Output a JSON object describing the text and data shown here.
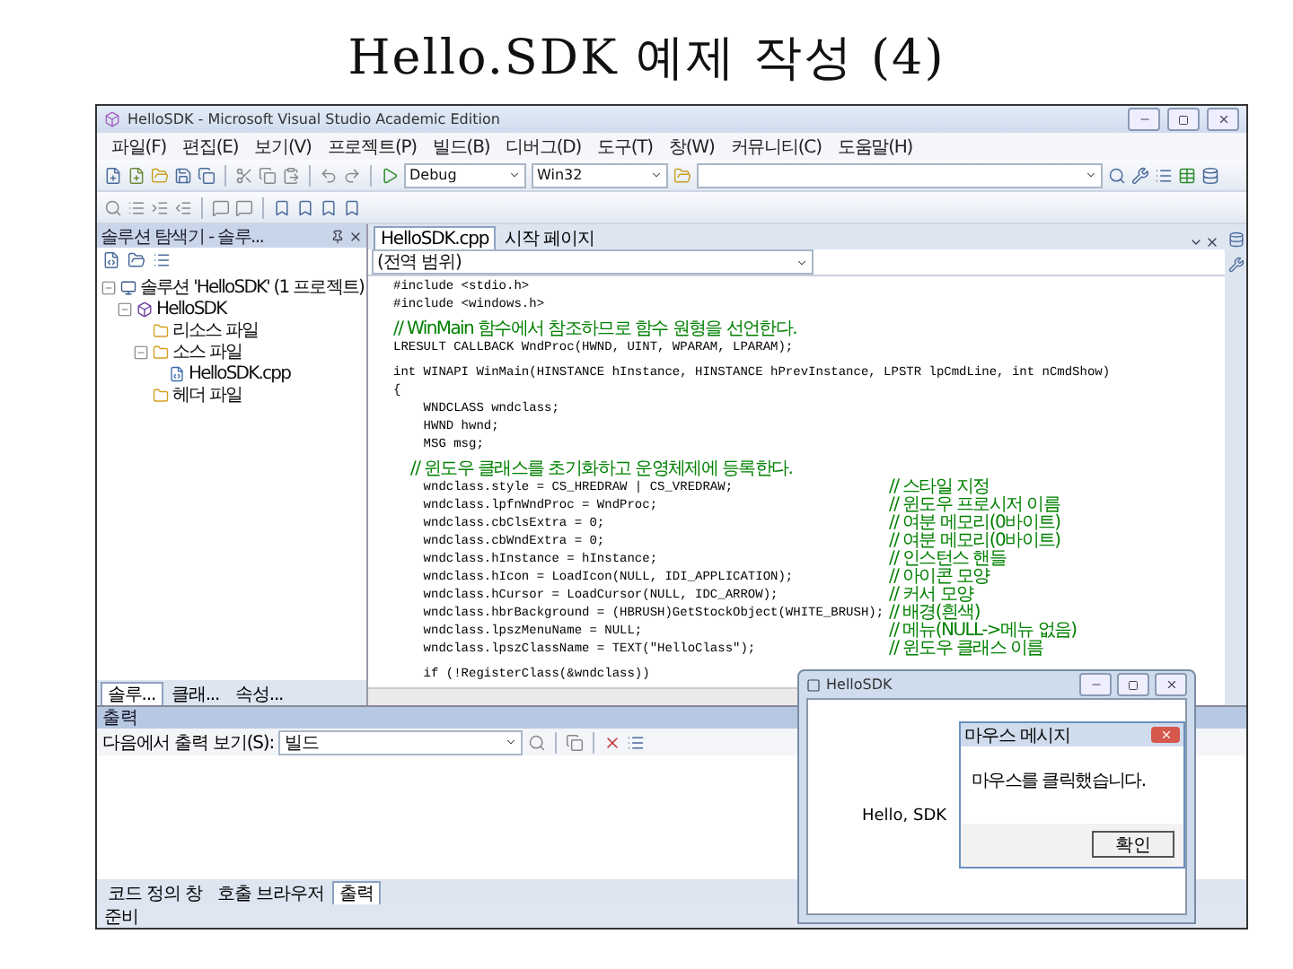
{
  "slide_title": "Hello.SDK 예제 작성 (4)",
  "ide": {
    "window_title": "HelloSDK - Microsoft Visual Studio Academic Edition",
    "menu": [
      "파일(F)",
      "편집(E)",
      "보기(V)",
      "프로젝트(P)",
      "빌드(B)",
      "디버그(D)",
      "도구(T)",
      "창(W)",
      "커뮤니티(C)",
      "도움말(H)"
    ],
    "toolbar": {
      "configuration": "Debug",
      "platform": "Win32"
    },
    "solution_explorer": {
      "title": "솔루션 탐색기 - 솔루...",
      "tree": [
        {
          "label": "솔루션 'HelloSDK' (1 프로젝트)",
          "kind": "solution",
          "children": [
            {
              "label": "HelloSDK",
              "kind": "project",
              "children": [
                {
                  "label": "리소스 파일",
                  "kind": "folder"
                },
                {
                  "label": "소스 파일",
                  "kind": "folder",
                  "children": [
                    {
                      "label": "HelloSDK.cpp",
                      "kind": "file"
                    }
                  ]
                },
                {
                  "label": "헤더 파일",
                  "kind": "folder"
                }
              ]
            }
          ]
        }
      ],
      "tabs": [
        {
          "label": "솔루...",
          "selected": true
        },
        {
          "label": "클래...",
          "selected": false
        },
        {
          "label": "속성...",
          "selected": false
        }
      ]
    },
    "editor": {
      "tabs": [
        {
          "label": "HelloSDK.cpp",
          "selected": true
        },
        {
          "label": "시작 페이지",
          "selected": false
        }
      ],
      "scope": "(전역 범위)",
      "lines": [
        {
          "kind": "code",
          "code": "#include <stdio.h>"
        },
        {
          "kind": "code",
          "code": "#include <windows.h>"
        },
        {
          "kind": "blank"
        },
        {
          "kind": "comment",
          "comment": "// WinMain 함수에서 참조하므로 함수 원형을 선언한다."
        },
        {
          "kind": "code",
          "code": "LRESULT CALLBACK WndProc(HWND, UINT, WPARAM, LPARAM);"
        },
        {
          "kind": "blank"
        },
        {
          "kind": "code",
          "code": "int WINAPI WinMain(HINSTANCE hInstance, HINSTANCE hPrevInstance, LPSTR lpCmdLine, int nCmdShow)"
        },
        {
          "kind": "code",
          "code": "{"
        },
        {
          "kind": "code",
          "code": "    WNDCLASS wndclass;"
        },
        {
          "kind": "code",
          "code": "    HWND hwnd;"
        },
        {
          "kind": "code",
          "code": "    MSG msg;"
        },
        {
          "kind": "blank"
        },
        {
          "kind": "comment",
          "comment": "    // 윈도우 클래스를 초기화하고 운영체제에 등록한다."
        },
        {
          "kind": "code",
          "code": "    wndclass.style = CS_HREDRAW | CS_VREDRAW;",
          "comment": "// 스타일 지정"
        },
        {
          "kind": "code",
          "code": "    wndclass.lpfnWndProc = WndProc;",
          "comment": "// 윈도우 프로시저 이름"
        },
        {
          "kind": "code",
          "code": "    wndclass.cbClsExtra = 0;",
          "comment": "// 여분 메모리(0바이트)"
        },
        {
          "kind": "code",
          "code": "    wndclass.cbWndExtra = 0;",
          "comment": "// 여분 메모리(0바이트)"
        },
        {
          "kind": "code",
          "code": "    wndclass.hInstance = hInstance;",
          "comment": "// 인스턴스 핸들"
        },
        {
          "kind": "code",
          "code": "    wndclass.hIcon = LoadIcon(NULL, IDI_APPLICATION);",
          "comment": "// 아이콘 모양"
        },
        {
          "kind": "code",
          "code": "    wndclass.hCursor = LoadCursor(NULL, IDC_ARROW);",
          "comment": "// 커서 모양"
        },
        {
          "kind": "code",
          "code": "    wndclass.hbrBackground = (HBRUSH)GetStockObject(WHITE_BRUSH);",
          "comment": "// 배경(흰색)"
        },
        {
          "kind": "code",
          "code": "    wndclass.lpszMenuName = NULL;",
          "comment": "// 메뉴(NULL->메뉴 없음)"
        },
        {
          "kind": "code",
          "code": "    wndclass.lpszClassName = TEXT(\"HelloClass\");",
          "comment": "// 윈도우 클래스 이름"
        },
        {
          "kind": "blank"
        },
        {
          "kind": "code",
          "code": "    if (!RegisterClass(&wndclass))"
        }
      ]
    },
    "output": {
      "title": "출력",
      "show_label": "다음에서 출력 보기(S):",
      "source": "빌드"
    },
    "bottom_tabs": [
      {
        "label": "코드 정의 창",
        "selected": false
      },
      {
        "label": "호출 브라우저",
        "selected": false
      },
      {
        "label": "출력",
        "selected": true
      }
    ],
    "status": "준비"
  },
  "app_window": {
    "title": "HelloSDK",
    "text": "Hello, SDK",
    "message_box": {
      "title": "마우스 메시지",
      "message": "마우스를 클릭했습니다.",
      "button": "확인"
    }
  }
}
